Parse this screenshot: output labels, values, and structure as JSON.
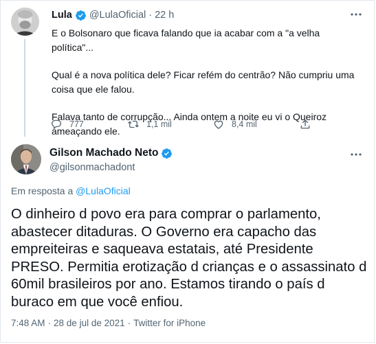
{
  "tweet1": {
    "author_name": "Lula",
    "author_handle": "@LulaOficial",
    "dot": "·",
    "time_ago": "22 h",
    "paragraphs": [
      "E o Bolsonaro que ficava falando que ia acabar com a \"a velha política\"...",
      "Qual é a nova política dele? Ficar refém do centrão? Não cumpriu uma coisa que ele falou.",
      "Falava tanto de corrupção... Ainda ontem a noite eu vi o Queiroz ameaçando ele."
    ],
    "replies": "777",
    "retweets": "1,1 mil",
    "likes": "8,4 mil"
  },
  "tweet2": {
    "author_name": "Gilson Machado Neto",
    "author_handle": "@gilsonmachadont",
    "reply_prefix": "Em resposta a",
    "reply_handle": "@LulaOficial",
    "text": "O dinheiro d povo era para comprar o parlamento, abastecer ditaduras. O Governo era capacho das empreiteiras e saqueava estatais, até Presidente PRESO. Permitia erotização d crianças e o assassinato d 60mil brasileiros por ano. Estamos tirando o país d buraco em que você enfiou.",
    "time": "7:48 AM",
    "date": "28 de jul de 2021",
    "source": "Twitter for iPhone",
    "dot": "·"
  },
  "colors": {
    "verified": "#1d9bf0",
    "link": "#1d9bf0",
    "muted": "#536471",
    "text": "#0f1419"
  },
  "icons": [
    "verified-badge-icon",
    "more-icon",
    "reply-icon",
    "retweet-icon",
    "like-icon",
    "share-icon"
  ]
}
